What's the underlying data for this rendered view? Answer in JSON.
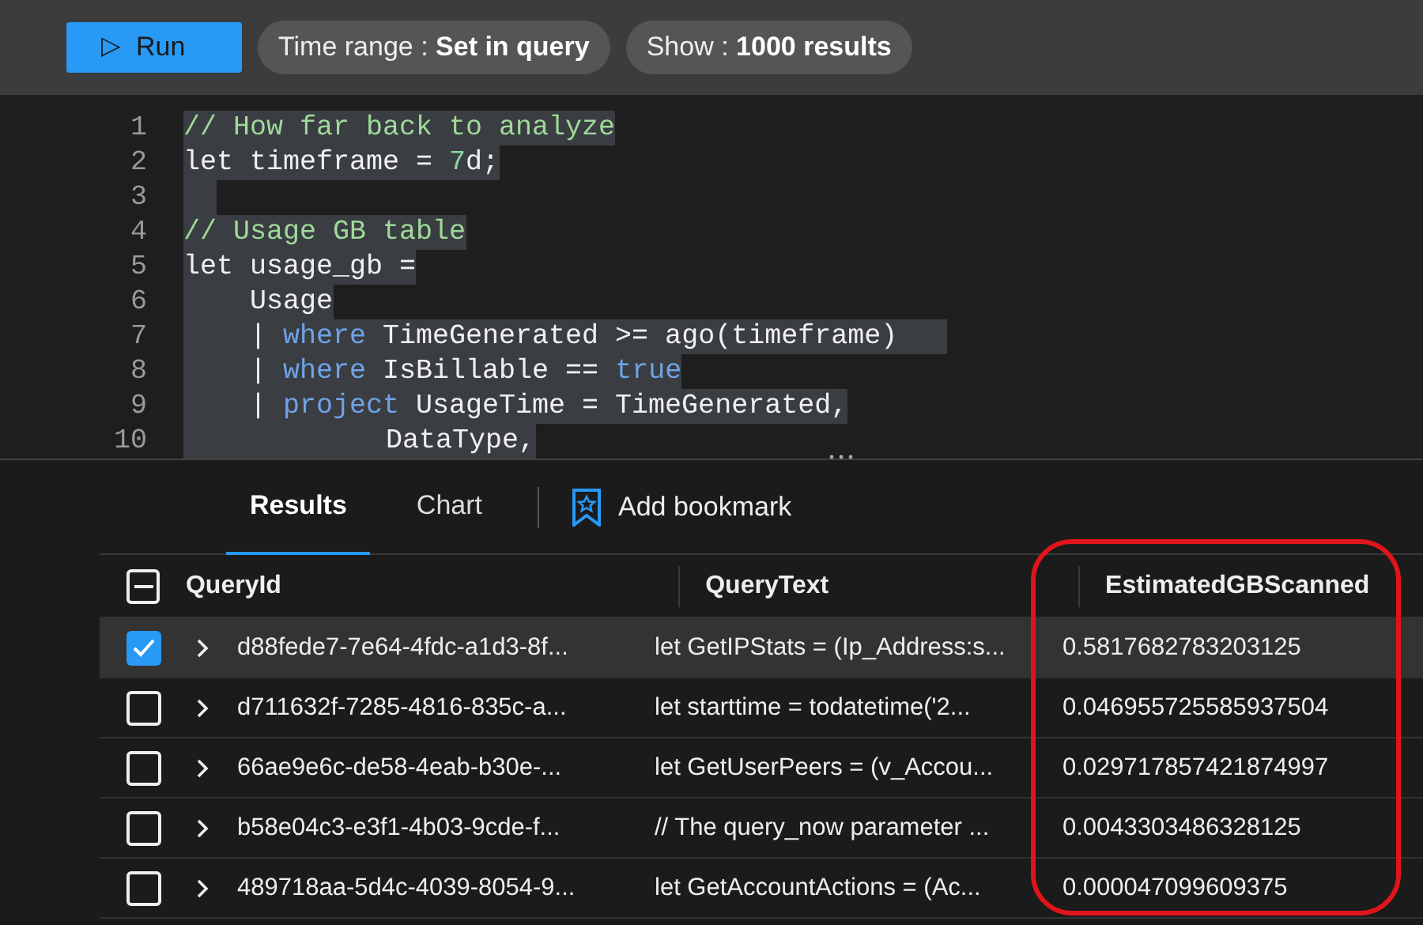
{
  "toolbar": {
    "run_button": {
      "icon": "▷",
      "label": "Run"
    },
    "pills": [
      {
        "label": "Time range : ",
        "value": "Set in query"
      },
      {
        "label": "Show : ",
        "value": "1000 results"
      }
    ]
  },
  "editor": {
    "lines": [
      {
        "number": "1",
        "kind": "top",
        "tokens": [
          {
            "kind": "comment",
            "text": "// How far back to analyze"
          }
        ]
      },
      {
        "number": "2",
        "kind": "top",
        "tokens": [
          {
            "kind": "plain",
            "text": "let timeframe = "
          },
          {
            "kind": "number",
            "text": "7"
          },
          {
            "kind": "plain",
            "text": "d;"
          }
        ]
      },
      {
        "number": "3",
        "kind": "blank"
      },
      {
        "number": "4",
        "kind": "top",
        "tokens": [
          {
            "kind": "comment",
            "text": "// Usage GB table"
          }
        ]
      },
      {
        "number": "5",
        "kind": "top",
        "tokens": [
          {
            "kind": "plain",
            "text": "let usage_gb ="
          }
        ]
      },
      {
        "number": "6",
        "kind": "body",
        "tokens": [
          {
            "kind": "plain",
            "text": "Usage"
          }
        ]
      },
      {
        "number": "7",
        "kind": "body",
        "tokens": [
          {
            "kind": "plain",
            "text": "| "
          },
          {
            "kind": "keyword",
            "text": "where"
          },
          {
            "kind": "plain",
            "text": " TimeGenerated >= ago(timeframe)   "
          }
        ]
      },
      {
        "number": "8",
        "kind": "body",
        "tokens": [
          {
            "kind": "plain",
            "text": "| "
          },
          {
            "kind": "keyword",
            "text": "where"
          },
          {
            "kind": "plain",
            "text": " IsBillable == "
          },
          {
            "kind": "keyword",
            "text": "true"
          }
        ]
      },
      {
        "number": "9",
        "kind": "body",
        "tokens": [
          {
            "kind": "plain",
            "text": "| "
          },
          {
            "kind": "keyword",
            "text": "project"
          },
          {
            "kind": "plain",
            "text": " UsageTime = TimeGenerated,"
          }
        ]
      },
      {
        "number": "10",
        "kind": "continuation",
        "tokens": [
          {
            "kind": "plain",
            "text": "DataType,"
          }
        ]
      }
    ]
  },
  "results": {
    "tabs": [
      {
        "label": "Results",
        "selected": true
      },
      {
        "label": "Chart",
        "selected": false
      }
    ],
    "bookmark_button": "Add bookmark",
    "table": {
      "select_all_partial": true,
      "columns": [
        "QueryId",
        "QueryText",
        "EstimatedGBScanned"
      ],
      "rows": [
        {
          "checked": true,
          "selected": true,
          "cells": [
            "d88fede7-7e64-4fdc-a1d3-8f...",
            "let GetIPStats = (Ip_Address:s...",
            "0.5817682783203125"
          ]
        },
        {
          "checked": false,
          "selected": false,
          "cells": [
            "d711632f-7285-4816-835c-a...",
            "let starttime = todatetime('2...",
            "0.046955725585937504"
          ]
        },
        {
          "checked": false,
          "selected": false,
          "cells": [
            "66ae9e6c-de58-4eab-b30e-...",
            "let GetUserPeers = (v_Accou...",
            "0.029717857421874997"
          ]
        },
        {
          "checked": false,
          "selected": false,
          "cells": [
            "b58e04c3-e3f1-4b03-9cde-f...",
            "// The query_now parameter ...",
            "0.0043303486328125"
          ]
        },
        {
          "checked": false,
          "selected": false,
          "cells": [
            "489718aa-5d4c-4039-8054-9...",
            "let GetAccountActions = (Ac...",
            "0.000047099609375"
          ]
        }
      ]
    }
  }
}
